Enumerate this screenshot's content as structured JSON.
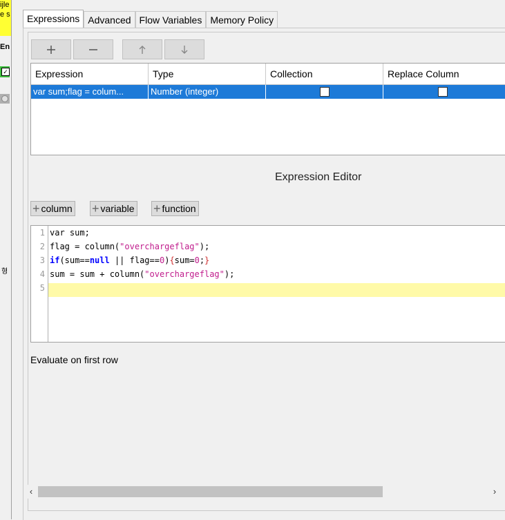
{
  "background_window": {
    "yellow_lines": [
      "ijle",
      "e s"
    ],
    "en_label": "En",
    "side_char": "형"
  },
  "tabs": [
    {
      "label": "Expressions",
      "active": true
    },
    {
      "label": "Advanced"
    },
    {
      "label": "Flow Variables"
    },
    {
      "label": "Memory Policy"
    }
  ],
  "toolbar": {
    "add_icon": "plus-icon",
    "remove_icon": "minus-icon",
    "up_icon": "arrow-up-icon",
    "down_icon": "arrow-down-icon"
  },
  "table": {
    "headers": [
      "Expression",
      "Type",
      "Collection",
      "Replace Column"
    ],
    "rows": [
      {
        "expression": "var sum;flag = colum...",
        "type": "Number (integer)",
        "collection": false,
        "replace_column": false
      }
    ],
    "selected_color": "#1d7ad8"
  },
  "editor": {
    "title": "Expression Editor",
    "add_buttons": [
      "column",
      "variable",
      "function"
    ],
    "line_numbers": [
      "1",
      "2",
      "3",
      "4",
      "5"
    ]
  },
  "evaluate_label": "Evaluate on first row"
}
